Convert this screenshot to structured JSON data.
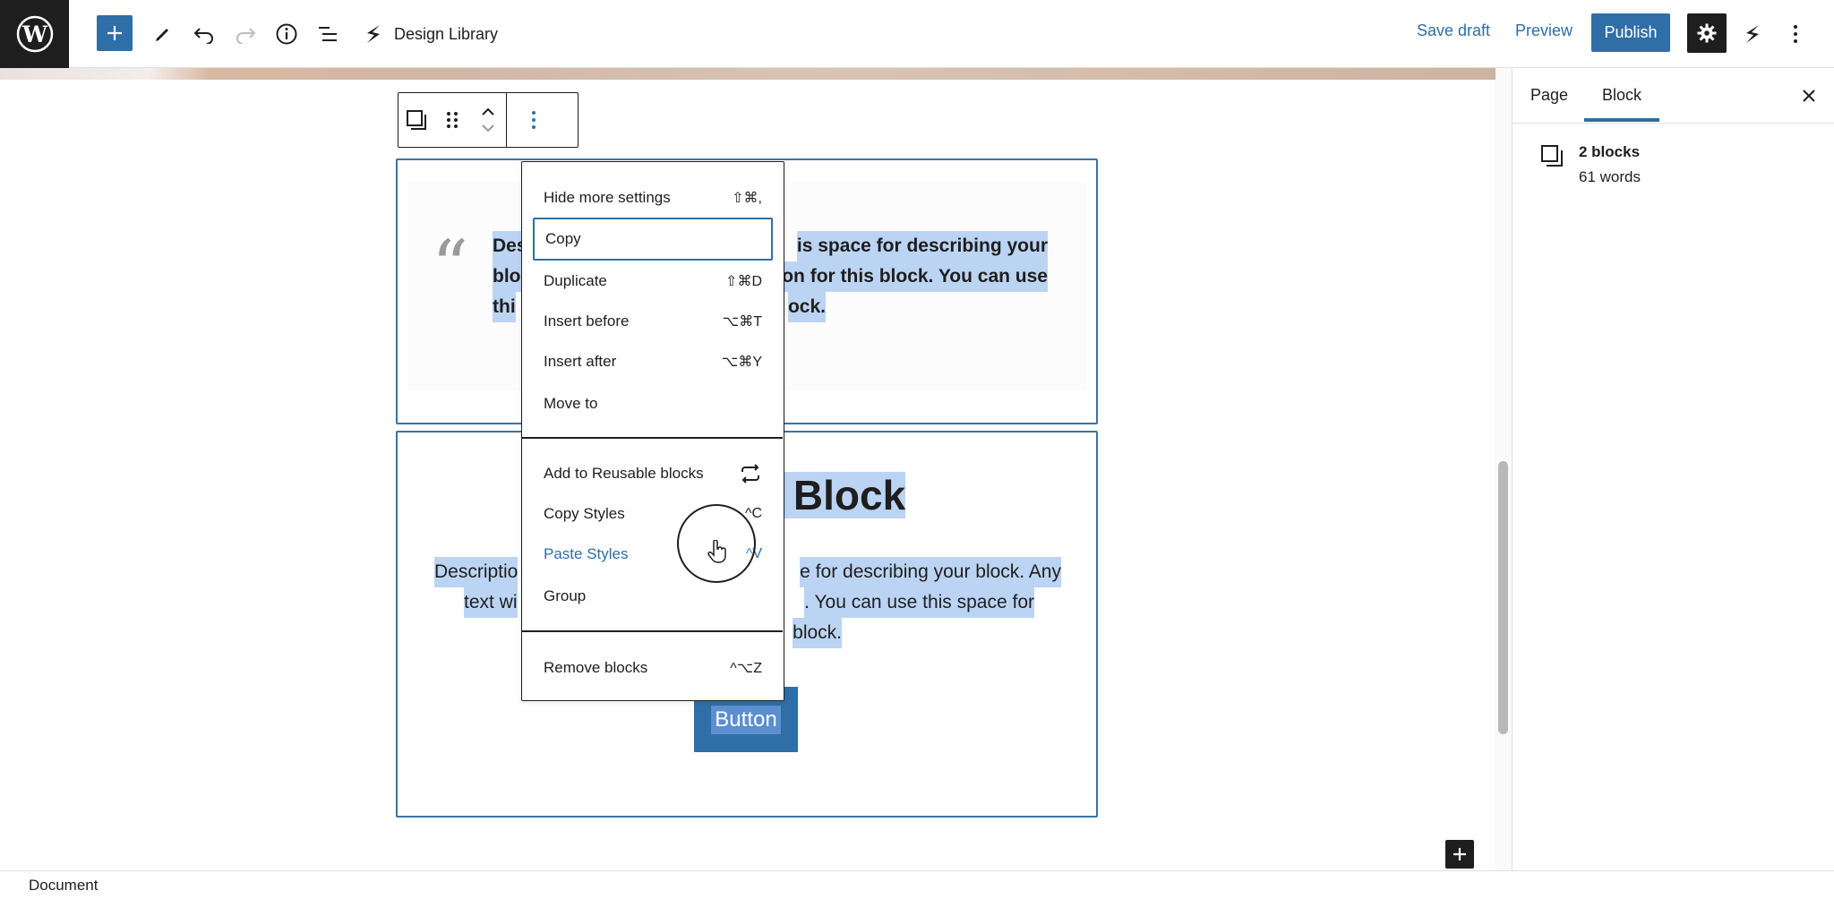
{
  "topbar": {
    "design_library": "Design Library",
    "save_draft": "Save draft",
    "preview": "Preview",
    "publish": "Publish"
  },
  "content": {
    "quote_lines": [
      "Des",
      "is space for describing your",
      "blo",
      "on for this block. You can use",
      "thi",
      "ock."
    ],
    "heading": "is Block",
    "desc_lines": [
      "Descriptio",
      "e for describing your block. Any",
      "text wi",
      ". You can use this space for",
      "block."
    ],
    "button_label": "Button"
  },
  "menu": {
    "items": [
      {
        "label": "Hide more settings",
        "shortcut": "⇧⌘,"
      },
      {
        "label": "Copy",
        "shortcut": ""
      },
      {
        "label": "Duplicate",
        "shortcut": "⇧⌘D"
      },
      {
        "label": "Insert before",
        "shortcut": "⌥⌘T"
      },
      {
        "label": "Insert after",
        "shortcut": "⌥⌘Y"
      },
      {
        "label": "Move to",
        "shortcut": ""
      },
      {
        "label": "Add to Reusable blocks",
        "shortcut": ""
      },
      {
        "label": "Copy Styles",
        "shortcut": "^C"
      },
      {
        "label": "Paste Styles",
        "shortcut": "^V"
      },
      {
        "label": "Group",
        "shortcut": ""
      },
      {
        "label": "Remove blocks",
        "shortcut": "^⌥Z"
      }
    ]
  },
  "sidebar": {
    "tab_page": "Page",
    "tab_block": "Block",
    "blocks_count": "2 blocks",
    "words_count": "61 words"
  },
  "footer": {
    "document": "Document"
  },
  "colors": {
    "accent": "#2f6ea6",
    "selection": "#bcd4f3",
    "dark": "#1e1e1e"
  }
}
